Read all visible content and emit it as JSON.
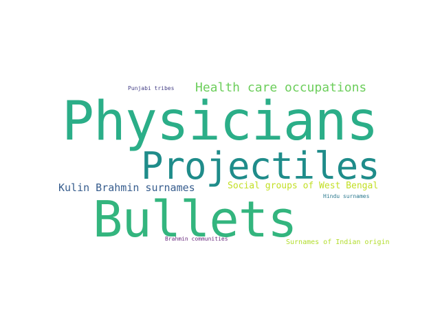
{
  "words": [
    {
      "text": "Physicians",
      "color": "#2bae88"
    },
    {
      "text": "Bullets",
      "color": "#33b57e"
    },
    {
      "text": "Projectiles",
      "color": "#1f8c8a"
    },
    {
      "text": "Health care occupations",
      "color": "#6cce5b"
    },
    {
      "text": "Kulin Brahmin surnames",
      "color": "#365c8d"
    },
    {
      "text": "Social groups of West Bengal",
      "color": "#c2df23"
    },
    {
      "text": "Surnames of Indian origin",
      "color": "#b2dd2c"
    },
    {
      "text": "Punjabi tribes",
      "color": "#433e85"
    },
    {
      "text": "Hindu surnames",
      "color": "#2a788e"
    },
    {
      "text": "Brahmin communities",
      "color": "#6a2a7e"
    }
  ]
}
